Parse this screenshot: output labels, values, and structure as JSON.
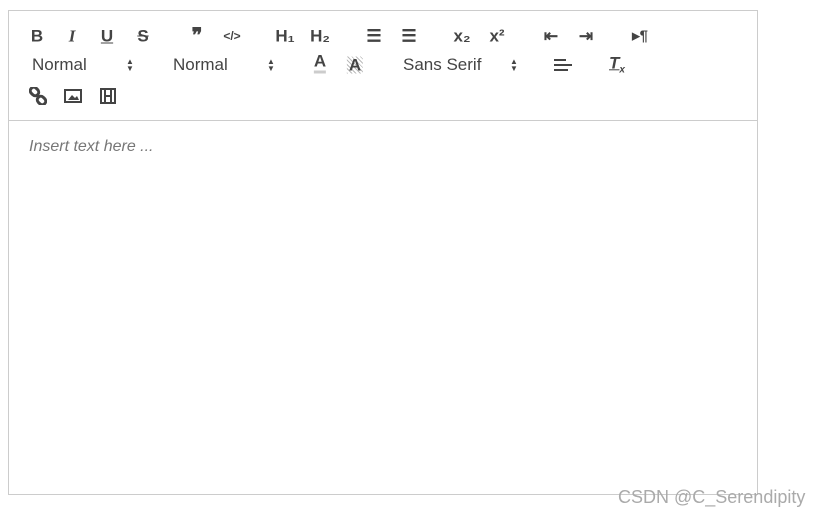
{
  "toolbar": {
    "buttons": [
      {
        "name": "bold",
        "glyph": "B"
      },
      {
        "name": "italic",
        "glyph": "I"
      },
      {
        "name": "underline",
        "glyph": "U"
      },
      {
        "name": "strike",
        "glyph": "S"
      },
      {
        "name": "blockquote",
        "glyph": "❞"
      },
      {
        "name": "code-block",
        "glyph": "</>"
      },
      {
        "name": "header-1",
        "glyph": "H₁"
      },
      {
        "name": "header-2",
        "glyph": "H₂"
      },
      {
        "name": "ordered-list",
        "glyph": "☰"
      },
      {
        "name": "bullet-list",
        "glyph": "☰"
      },
      {
        "name": "subscript",
        "glyph": "x₂"
      },
      {
        "name": "superscript",
        "glyph": "x²"
      },
      {
        "name": "outdent",
        "glyph": "⇤"
      },
      {
        "name": "indent",
        "glyph": "⇥"
      },
      {
        "name": "direction-rtl",
        "glyph": "▸¶"
      }
    ],
    "size_select": "Normal",
    "header_select": "Normal",
    "font_select": "Sans Serif",
    "icons": {
      "color": "text-color-icon",
      "background": "background-color-icon",
      "align": "align-icon",
      "clean": "clear-format-icon",
      "link": "link-icon",
      "image": "image-icon",
      "video": "video-icon"
    }
  },
  "editor": {
    "placeholder": "Insert text here ..."
  },
  "watermark": "CSDN @C_Serendipity"
}
